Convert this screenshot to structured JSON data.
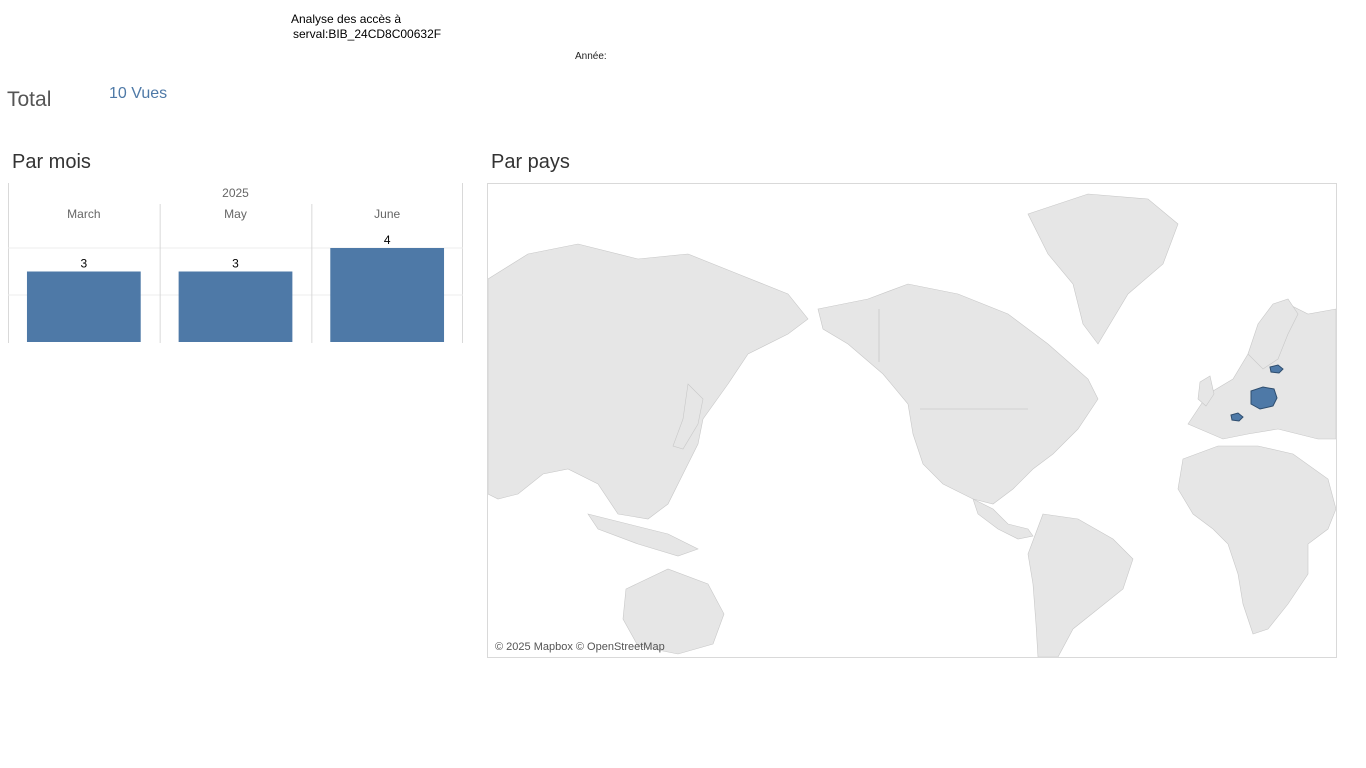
{
  "header": {
    "title_line1": "Analyse des accès à",
    "title_line2": "serval:BIB_24CD8C00632F",
    "year_filter_label": "Année:"
  },
  "summary": {
    "total_label": "Total",
    "total_value": "10 Vues"
  },
  "sections": {
    "by_month": "Par mois",
    "by_country": "Par pays"
  },
  "map": {
    "attribution": "© 2025 Mapbox © OpenStreetMap",
    "land_color": "#e6e6e6",
    "highlight_color": "#4e79a7",
    "highlighted_countries": [
      "Poland",
      "Switzerland",
      "Estonia"
    ]
  },
  "chart_data": {
    "type": "bar",
    "column_header": "2025",
    "categories": [
      "March",
      "May",
      "June"
    ],
    "values": [
      3,
      3,
      4
    ],
    "ylim": [
      0,
      4
    ],
    "bar_color": "#4e79a7",
    "grid": true,
    "data_labels": [
      "3",
      "3",
      "4"
    ]
  }
}
